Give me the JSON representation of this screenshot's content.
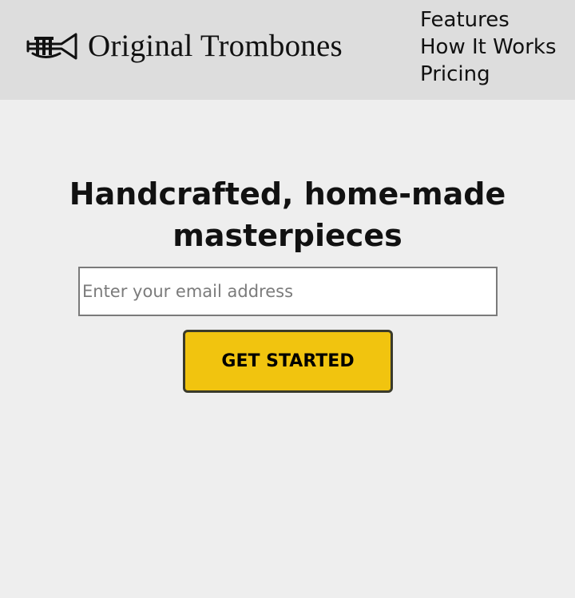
{
  "brand": {
    "name": "Original Trombones",
    "logo_icon": "trumpet-icon"
  },
  "nav": {
    "items": [
      "Features",
      "How It Works",
      "Pricing"
    ]
  },
  "hero": {
    "title": "Handcrafted, home-made masterpieces",
    "email_placeholder": "Enter your email address",
    "cta_label": "GET STARTED"
  },
  "colors": {
    "header_bg": "#dddddd",
    "page_bg": "#eeeeee",
    "cta_bg": "#f1c40f"
  }
}
